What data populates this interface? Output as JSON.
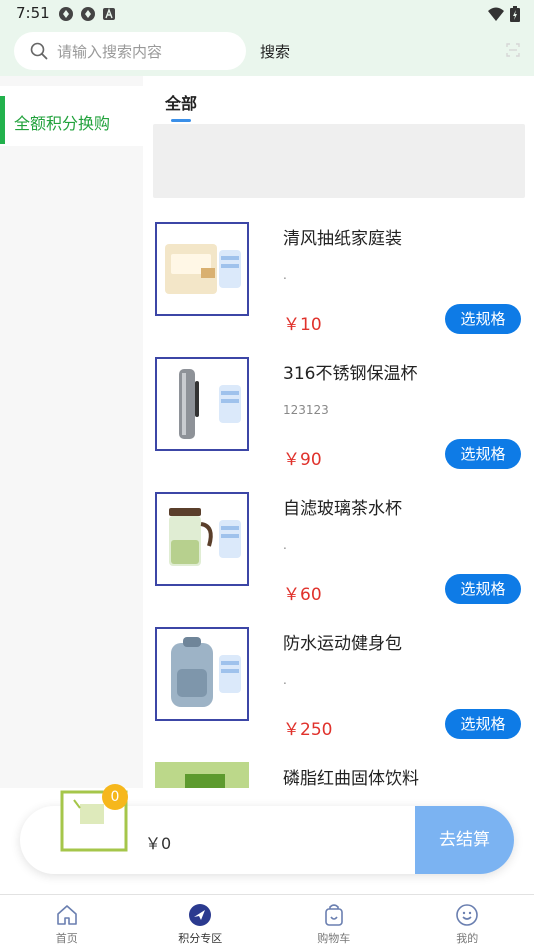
{
  "status_bar": {
    "time": "7:51"
  },
  "header": {
    "search_placeholder": "请输入搜索内容",
    "search_button": "搜索"
  },
  "sidebar": {
    "items": [
      {
        "label": "全额积分换购",
        "active": true
      }
    ]
  },
  "tabs": [
    {
      "label": "全部",
      "active": true
    }
  ],
  "products": [
    {
      "name": "清风抽纸家庭装",
      "desc": ".",
      "price": "￥10",
      "button": "选规格"
    },
    {
      "name": "316不锈钢保温杯",
      "desc": "123123",
      "price": "￥90",
      "button": "选规格"
    },
    {
      "name": "自滤玻璃茶水杯",
      "desc": ".",
      "price": "￥60",
      "button": "选规格"
    },
    {
      "name": "防水运动健身包",
      "desc": ".",
      "price": "￥250",
      "button": "选规格"
    },
    {
      "name": "磷脂红曲固体饮料"
    }
  ],
  "cart": {
    "count": "0",
    "total": "￥0",
    "checkout": "去结算"
  },
  "bottom_nav": [
    {
      "label": "首页",
      "icon": "home-icon"
    },
    {
      "label": "积分专区",
      "icon": "points-icon",
      "active": true
    },
    {
      "label": "购物车",
      "icon": "shopping-bag-icon"
    },
    {
      "label": "我的",
      "icon": "profile-icon"
    }
  ],
  "colors": {
    "accent_blue": "#0e7be6",
    "price_red": "#e0322c",
    "sidebar_green": "#22a23c",
    "header_bg": "#eaf6ed"
  }
}
